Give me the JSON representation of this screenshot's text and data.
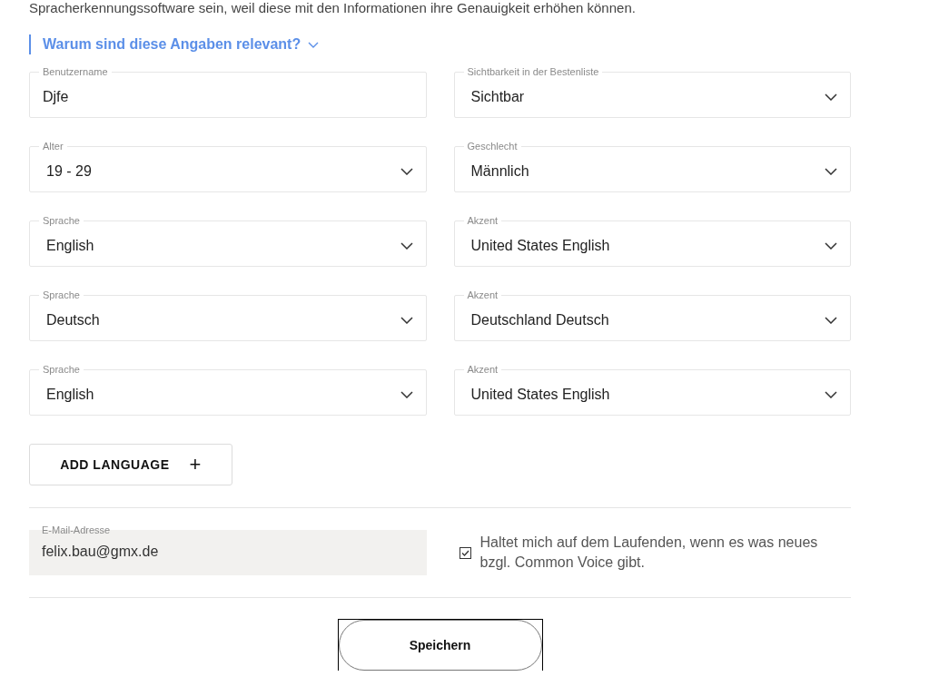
{
  "intro_text": "Spracherkennungssoftware sein, weil diese mit den Informationen ihre Genauigkeit erhöhen können.",
  "info_toggle": {
    "label": "Warum sind diese Angaben relevant?",
    "expanded": false
  },
  "fields": [
    {
      "label": "Benutzername",
      "value": "Djfe",
      "kind": "text"
    },
    {
      "label": "Sichtbarkeit in der Bestenliste",
      "value": "Sichtbar",
      "kind": "select"
    },
    {
      "label": "Alter",
      "value": "19 - 29",
      "kind": "select"
    },
    {
      "label": "Geschlecht",
      "value": "Männlich",
      "kind": "select"
    },
    {
      "label": "Sprache",
      "value": "English",
      "kind": "select"
    },
    {
      "label": "Akzent",
      "value": "United States English",
      "kind": "select"
    },
    {
      "label": "Sprache",
      "value": "Deutsch",
      "kind": "select"
    },
    {
      "label": "Akzent",
      "value": "Deutschland Deutsch",
      "kind": "select"
    },
    {
      "label": "Sprache",
      "value": "English",
      "kind": "select"
    },
    {
      "label": "Akzent",
      "value": "United States English",
      "kind": "select"
    }
  ],
  "add_language_button": {
    "label": "ADD LANGUAGE",
    "icon": "+"
  },
  "email": {
    "label": "E-Mail-Adresse",
    "value": "felix.bau@gmx.de",
    "disabled": true
  },
  "newsletter": {
    "label": "Haltet mich auf dem Laufenden, wenn es was neues bzgl. Common Voice gibt.",
    "checked": true
  },
  "save_button": {
    "label": "Speichern",
    "focused": true
  }
}
